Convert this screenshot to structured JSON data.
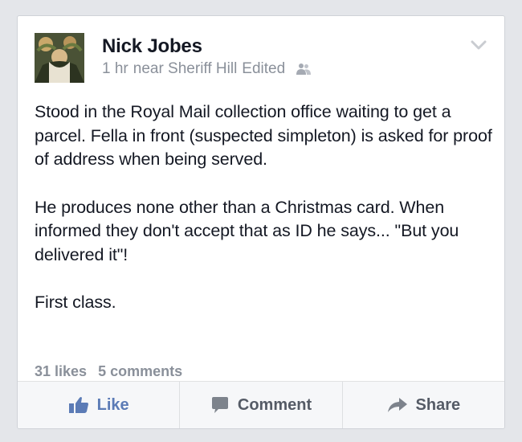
{
  "post": {
    "author": "Nick Jobes",
    "time": "1 hr",
    "location": "near Sheriff Hill",
    "edited": "Edited",
    "audience_icon": "friends-icon",
    "paragraphs": [
      "Stood in the Royal Mail collection office waiting to get a parcel. Fella in front (suspected simpleton) is asked for proof of address when being served.",
      "He produces none other than a Christmas card. When informed they don't accept that as ID he says... \"But you delivered it\"!",
      "First class."
    ]
  },
  "stats": {
    "likes": "31 likes",
    "comments": "5 comments"
  },
  "actions": {
    "like": "Like",
    "comment": "Comment",
    "share": "Share"
  },
  "colors": {
    "link_blue": "#5b7bb6",
    "meta_gray": "#8a909a",
    "text": "#141823",
    "background": "#e4e6ea"
  }
}
